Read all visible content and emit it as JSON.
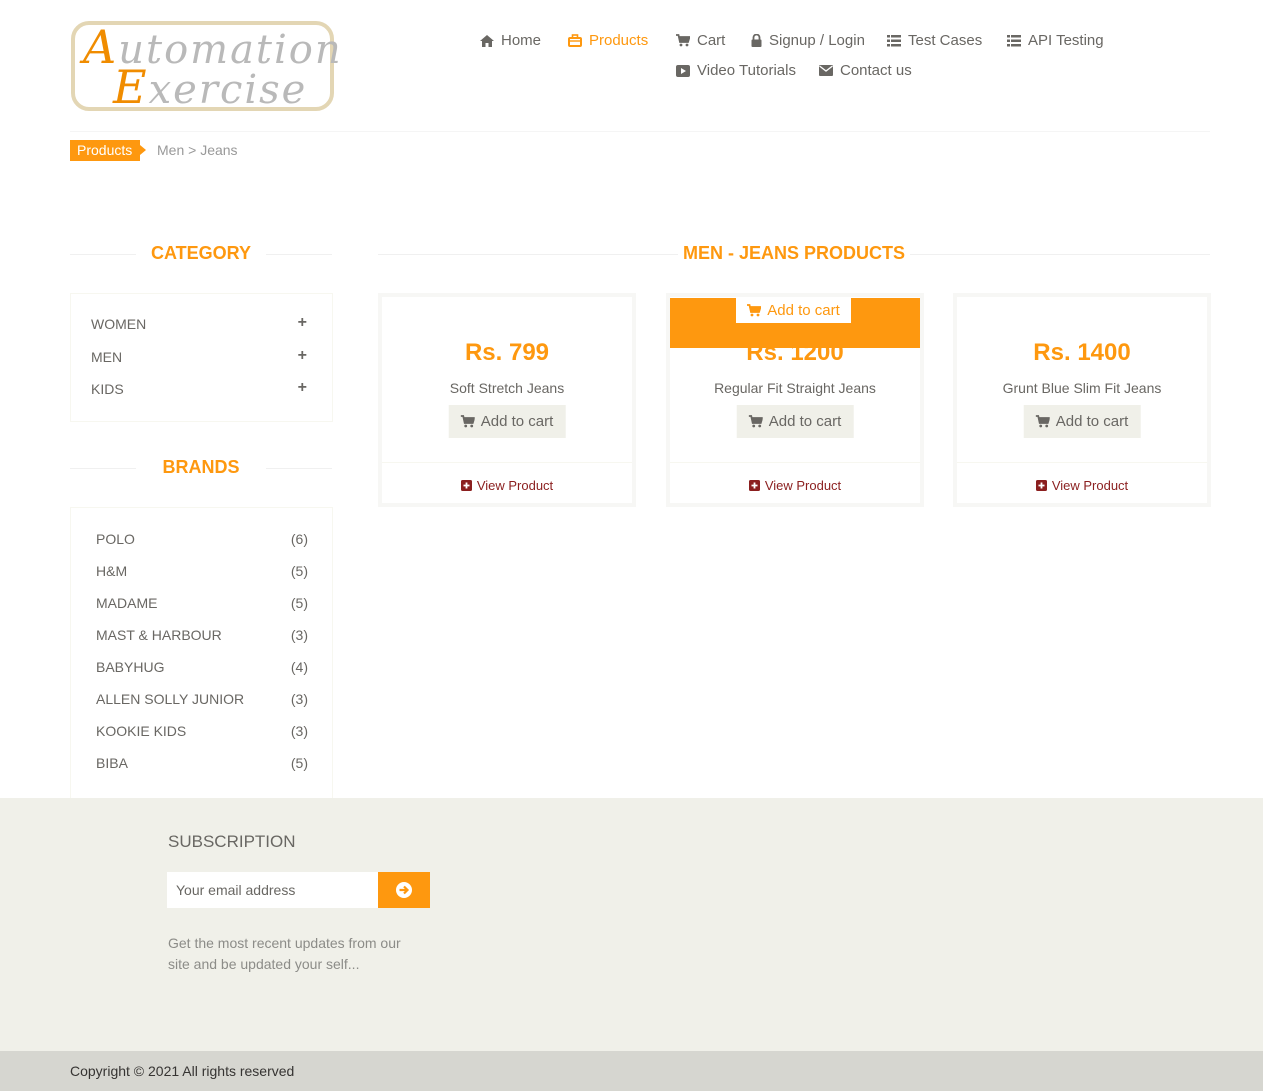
{
  "logo": {
    "line1_cap": "A",
    "line1_rest": "utomation",
    "line2_cap": "E",
    "line2_rest": "xercise"
  },
  "nav": {
    "home": "Home",
    "products": "Products",
    "cart": "Cart",
    "signup": "Signup / Login",
    "test_cases": "Test Cases",
    "api_testing": "API Testing",
    "video_tutorials": "Video Tutorials",
    "contact": "Contact us"
  },
  "breadcrumb": {
    "active": "Products",
    "rest": "Men > Jeans"
  },
  "sidebar": {
    "category_title": "CATEGORY",
    "categories": [
      {
        "label": "WOMEN"
      },
      {
        "label": "MEN"
      },
      {
        "label": "KIDS"
      }
    ],
    "brands_title": "BRANDS",
    "brands": [
      {
        "name": "POLO",
        "count": "(6)"
      },
      {
        "name": "H&M",
        "count": "(5)"
      },
      {
        "name": "MADAME",
        "count": "(5)"
      },
      {
        "name": "MAST & HARBOUR",
        "count": "(3)"
      },
      {
        "name": "BABYHUG",
        "count": "(4)"
      },
      {
        "name": "ALLEN SOLLY JUNIOR",
        "count": "(3)"
      },
      {
        "name": "KOOKIE KIDS",
        "count": "(3)"
      },
      {
        "name": "BIBA",
        "count": "(5)"
      }
    ]
  },
  "main": {
    "title": "MEN - JEANS PRODUCTS",
    "products": [
      {
        "price": "Rs. 799",
        "name": "Soft Stretch Jeans",
        "add_label": "Add to cart",
        "view_label": "View Product"
      },
      {
        "price": "Rs. 1200",
        "name": "Regular Fit Straight Jeans",
        "add_label": "Add to cart",
        "view_label": "View Product",
        "hover_add_label": "Add to cart"
      },
      {
        "price": "Rs. 1400",
        "name": "Grunt Blue Slim Fit Jeans",
        "add_label": "Add to cart",
        "view_label": "View Product"
      }
    ]
  },
  "footer": {
    "subscription_title": "SUBSCRIPTION",
    "email_placeholder": "Your email address",
    "subscription_text": "Get the most recent updates from our site and be updated your self...",
    "copyright": "Copyright © 2021 All rights reserved"
  },
  "colors": {
    "accent": "#fe980f",
    "text": "#696763",
    "footer_bg": "#f0f0e9",
    "link": "#8b1f1f"
  },
  "icons": [
    "home-icon",
    "products-icon",
    "cart-icon",
    "lock-icon",
    "list-icon",
    "youtube-icon",
    "envelope-icon",
    "plus-icon",
    "plus-square-icon",
    "arrow-circle-right-icon"
  ]
}
